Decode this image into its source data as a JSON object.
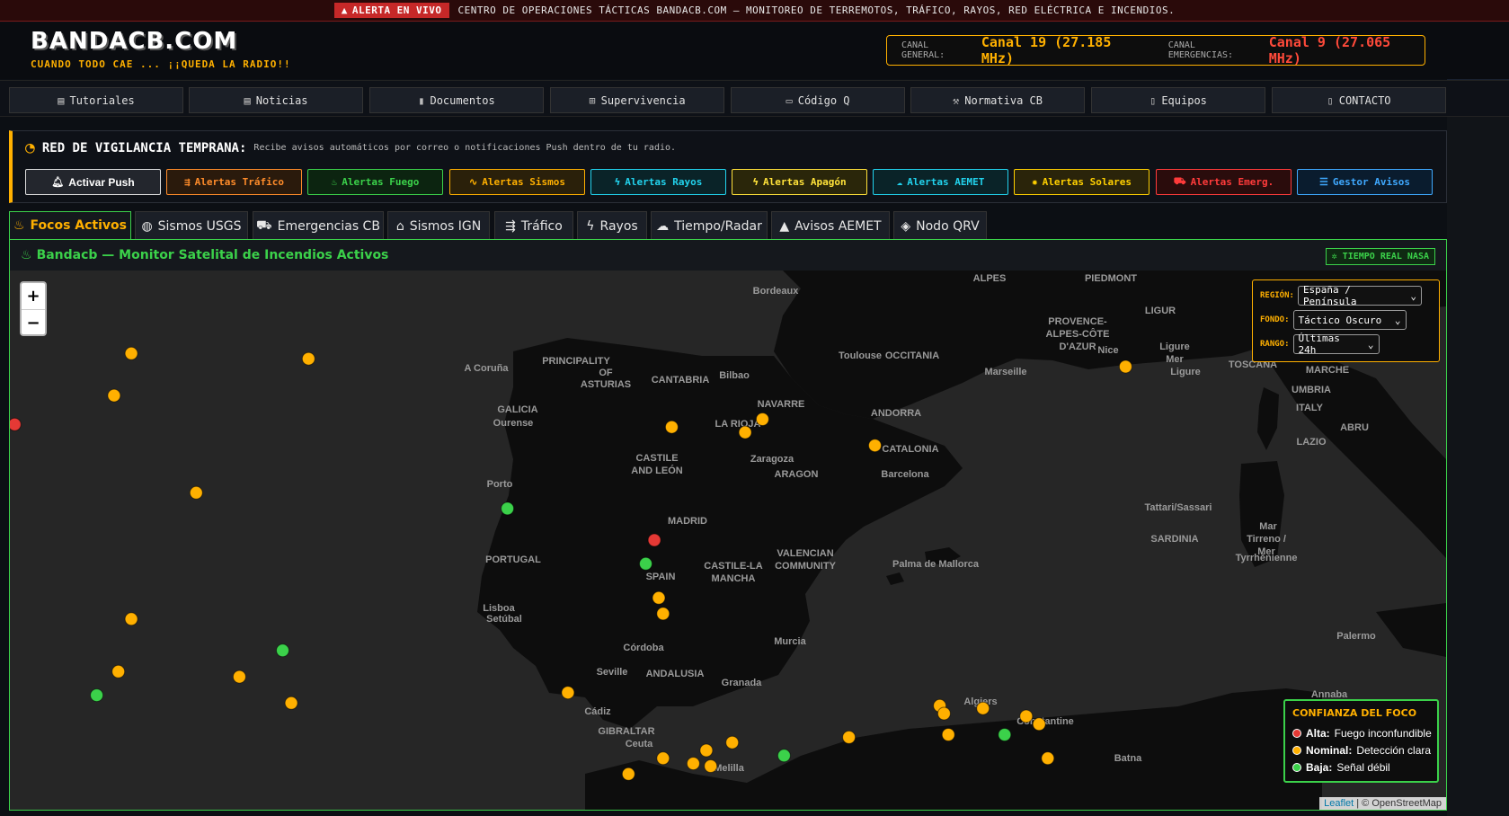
{
  "ticker": {
    "live_label": "ALERTA EN VIVO",
    "message": "CENTRO DE OPERACIONES TÁCTICAS BANDACB.COM — MONITOREO DE TERREMOTOS, TRÁFICO, RAYOS, RED ELÉCTRICA E INCENDIOS."
  },
  "header": {
    "logo": "BANDACB.COM",
    "tagline": "CUANDO TODO CAE ... ¡¡QUEDA LA RADIO!!",
    "channel_general_label": "CANAL GENERAL:",
    "channel_general_value": "Canal 19 (27.185 MHz)",
    "channel_emergency_label": "CANAL EMERGENCIAS:",
    "channel_emergency_value": "Canal 9 (27.065 MHz)"
  },
  "nav": [
    {
      "label": "Tutoriales",
      "icon": "newspaper-icon"
    },
    {
      "label": "Noticias",
      "icon": "newspaper-icon"
    },
    {
      "label": "Documentos",
      "icon": "file-icon"
    },
    {
      "label": "Supervivencia",
      "icon": "medkit-icon"
    },
    {
      "label": "Código Q",
      "icon": "id-card-icon"
    },
    {
      "label": "Normativa CB",
      "icon": "gavel-icon"
    },
    {
      "label": "Equipos",
      "icon": "radio-icon"
    },
    {
      "label": "CONTACTO",
      "icon": "radio-icon"
    }
  ],
  "vigilancia": {
    "title": "RED DE VIGILANCIA TEMPRANA:",
    "description": "Recibe avisos automáticos por correo o notificaciones Push dentro de tu radio.",
    "buttons": [
      {
        "label": "Activar Push",
        "icon": "bell-icon",
        "color": "#ffffff"
      },
      {
        "label": "Alertas Tráfico",
        "icon": "traffic-icon",
        "color": "#ff8c2a"
      },
      {
        "label": "Alertas Fuego",
        "icon": "fire-icon",
        "color": "#3bd14a"
      },
      {
        "label": "Alertas Sismos",
        "icon": "seismic-icon",
        "color": "#ffb000"
      },
      {
        "label": "Alertas Rayos",
        "icon": "bolt-icon",
        "color": "#22d3ee"
      },
      {
        "label": "Alertas Apagón",
        "icon": "bolt-icon",
        "color": "#ffe23a"
      },
      {
        "label": "Alertas AEMET",
        "icon": "cloud-icon",
        "color": "#22d3ee"
      },
      {
        "label": "Alertas Solares",
        "icon": "sun-icon",
        "color": "#ffd000"
      },
      {
        "label": "Alertas Emerg.",
        "icon": "truck-icon",
        "color": "#ff3b3b"
      },
      {
        "label": "Gestor Avisos",
        "icon": "sliders-icon",
        "color": "#3fa9ff"
      }
    ]
  },
  "tabs": [
    {
      "label": "Focos Activos",
      "icon": "fire-icon",
      "active": true
    },
    {
      "label": "Sismos USGS",
      "icon": "globe-icon"
    },
    {
      "label": "Emergencias CB",
      "icon": "truck-icon"
    },
    {
      "label": "Sismos IGN",
      "icon": "home-icon"
    },
    {
      "label": "Tráfico",
      "icon": "traffic-icon"
    },
    {
      "label": "Rayos",
      "icon": "bolt-icon"
    },
    {
      "label": "Tiempo/Radar",
      "icon": "cloud-icon"
    },
    {
      "label": "Avisos AEMET",
      "icon": "warning-icon"
    },
    {
      "label": "Nodo QRV",
      "icon": "node-icon"
    }
  ],
  "panel": {
    "title": "Bandacb — Monitor Satelital de Incendios Activos",
    "nasa_badge": "TIEMPO REAL NASA"
  },
  "filters": {
    "region_label": "REGIÓN:",
    "region_value": "España / Península",
    "fondo_label": "FONDO:",
    "fondo_value": "Táctico Oscuro",
    "rango_label": "RANGO:",
    "rango_value": "Últimas 24h"
  },
  "legend": {
    "title": "CONFIANZA DEL FOCO",
    "items": [
      {
        "level": "Alta:",
        "desc": "Fuego inconfundible",
        "color": "#e53935"
      },
      {
        "level": "Nominal:",
        "desc": "Detección clara",
        "color": "#ffb000"
      },
      {
        "level": "Baja:",
        "desc": "Señal débil",
        "color": "#3bd14a"
      }
    ]
  },
  "map_labels": [
    "Bordeaux",
    "ALPES",
    "PIEDMONT",
    "LIGUR",
    "PROVENCE-",
    "ALPES-CÔTE",
    "D'AZUR",
    "Nice",
    "Toulouse",
    "OCCITANIA",
    "Marseille",
    "Ligure",
    "Mer",
    "Ligure",
    "TOSCANA",
    "MARCHE",
    "UMBRIA",
    "ITALY",
    "LAZIO",
    "ABRU",
    "A Coruña",
    "PRINCIPALITY",
    "OF",
    "ASTURIAS",
    "CANTABRIA",
    "Bilbao",
    "NAVARRE",
    "ANDORRA",
    "GALICIA",
    "Ourense",
    "LA RIOJA",
    "CATALONIA",
    "Zaragoza",
    "ARAGON",
    "Barcelona",
    "CASTILE",
    "AND LEÓN",
    "Porto",
    "Tattari/Sassari",
    "MADRID",
    "SARDINIA",
    "PORTUGAL",
    "VALENCIAN",
    "COMMUNITY",
    "Palma de Mallorca",
    "SPAIN",
    "CASTILE-LA",
    "MANCHA",
    "Mar",
    "Tirreno /",
    "Mer",
    "Tyrrhénienne",
    "Lisboa",
    "Setúbal",
    "Córdoba",
    "Murcia",
    "Palermo",
    "Seville",
    "ANDALUSIA",
    "Granada",
    "Cádiz",
    "GIBRALTAR",
    "Ceuta",
    "Algiers",
    "Annaba",
    "Constantine",
    "Batna",
    "Melilla"
  ],
  "attribution": {
    "leaflet": "Leaflet",
    "osm": "| © OpenStreetMap"
  },
  "fire_points": [
    {
      "lat": 43.55,
      "lon": -6.35,
      "conf": "nominal"
    },
    {
      "lat": 43.45,
      "lon": -4.3,
      "conf": "nominal"
    },
    {
      "lat": 43.3,
      "lon": 5.15,
      "conf": "nominal"
    },
    {
      "lat": 42.75,
      "lon": -6.55,
      "conf": "nominal"
    },
    {
      "lat": 42.3,
      "lon": -8.6,
      "conf": "nominal"
    },
    {
      "lat": 42.2,
      "lon": -7.7,
      "conf": "alta"
    },
    {
      "lat": 42.15,
      "lon": -0.1,
      "conf": "nominal"
    },
    {
      "lat": 42.3,
      "lon": 0.95,
      "conf": "nominal"
    },
    {
      "lat": 42.05,
      "lon": 0.75,
      "conf": "nominal"
    },
    {
      "lat": 41.8,
      "lon": 2.25,
      "conf": "nominal"
    },
    {
      "lat": 41.25,
      "lon": -8.6,
      "conf": "nominal"
    },
    {
      "lat": 40.9,
      "lon": -5.6,
      "conf": "nominal"
    },
    {
      "lat": 40.6,
      "lon": -2.0,
      "conf": "baja"
    },
    {
      "lat": 40.0,
      "lon": -8.5,
      "conf": "nominal"
    },
    {
      "lat": 40.0,
      "lon": -0.3,
      "conf": "alta"
    },
    {
      "lat": 39.55,
      "lon": -0.4,
      "conf": "baja"
    },
    {
      "lat": 39.15,
      "lon": -9.05,
      "conf": "nominal"
    },
    {
      "lat": 38.95,
      "lon": -9.3,
      "conf": "nominal"
    },
    {
      "lat": 38.7,
      "lon": -9.0,
      "conf": "nominal"
    },
    {
      "lat": 38.9,
      "lon": -0.25,
      "conf": "nominal"
    },
    {
      "lat": 38.6,
      "lon": -0.2,
      "conf": "nominal"
    },
    {
      "lat": 38.5,
      "lon": -6.35,
      "conf": "nominal"
    },
    {
      "lat": 37.9,
      "lon": -4.6,
      "conf": "baja"
    },
    {
      "lat": 37.5,
      "lon": -6.5,
      "conf": "nominal"
    },
    {
      "lat": 37.4,
      "lon": -5.1,
      "conf": "nominal"
    },
    {
      "lat": 37.1,
      "lon": -1.3,
      "conf": "nominal"
    },
    {
      "lat": 37.05,
      "lon": -6.75,
      "conf": "baja"
    },
    {
      "lat": 36.9,
      "lon": -4.5,
      "conf": "nominal"
    },
    {
      "lat": 36.85,
      "lon": 3.0,
      "conf": "nominal"
    },
    {
      "lat": 36.8,
      "lon": 3.5,
      "conf": "nominal"
    },
    {
      "lat": 36.7,
      "lon": 3.05,
      "conf": "nominal"
    },
    {
      "lat": 36.65,
      "lon": 4.0,
      "conf": "nominal"
    },
    {
      "lat": 36.5,
      "lon": 4.15,
      "conf": "nominal"
    },
    {
      "lat": 36.25,
      "lon": 1.95,
      "conf": "nominal"
    },
    {
      "lat": 36.3,
      "lon": 3.1,
      "conf": "nominal"
    },
    {
      "lat": 36.3,
      "lon": 3.75,
      "conf": "baja"
    },
    {
      "lat": 36.15,
      "lon": 0.6,
      "conf": "nominal"
    },
    {
      "lat": 36.0,
      "lon": 0.3,
      "conf": "nominal"
    },
    {
      "lat": 35.9,
      "lon": 1.2,
      "conf": "baja"
    },
    {
      "lat": 35.85,
      "lon": -0.2,
      "conf": "nominal"
    },
    {
      "lat": 35.75,
      "lon": 0.15,
      "conf": "nominal"
    },
    {
      "lat": 35.7,
      "lon": 0.35,
      "conf": "nominal"
    },
    {
      "lat": 35.85,
      "lon": 4.25,
      "conf": "nominal"
    },
    {
      "lat": 35.55,
      "lon": -0.6,
      "conf": "nominal"
    }
  ]
}
